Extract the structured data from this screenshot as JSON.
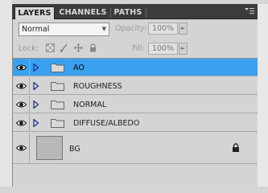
{
  "tabs": [
    {
      "label": "LAYERS",
      "active": true
    },
    {
      "label": "CHANNELS",
      "active": false
    },
    {
      "label": "PATHS",
      "active": false
    }
  ],
  "panel_menu_icon": "panel-menu-icon",
  "options": {
    "blend_mode": "Normal",
    "opacity_label": "Opacity:",
    "opacity_value": "100%",
    "lock_label": "Lock:",
    "fill_label": "Fill:",
    "fill_value": "100%"
  },
  "layers": [
    {
      "name": "AO",
      "type": "group",
      "selected": true,
      "visible": true
    },
    {
      "name": "ROUGHNESS",
      "type": "group",
      "selected": false,
      "visible": true
    },
    {
      "name": "NORMAL",
      "type": "group",
      "selected": false,
      "visible": true
    },
    {
      "name": "DIFFUSE/ALBEDO",
      "type": "group",
      "selected": false,
      "visible": true
    },
    {
      "name": "BG",
      "type": "background",
      "selected": false,
      "visible": true,
      "locked": true
    }
  ],
  "colors": {
    "selected_row": "#3aa0f0",
    "tab_bar": "#3c3c3c",
    "panel_bg": "#d4d4d4"
  }
}
